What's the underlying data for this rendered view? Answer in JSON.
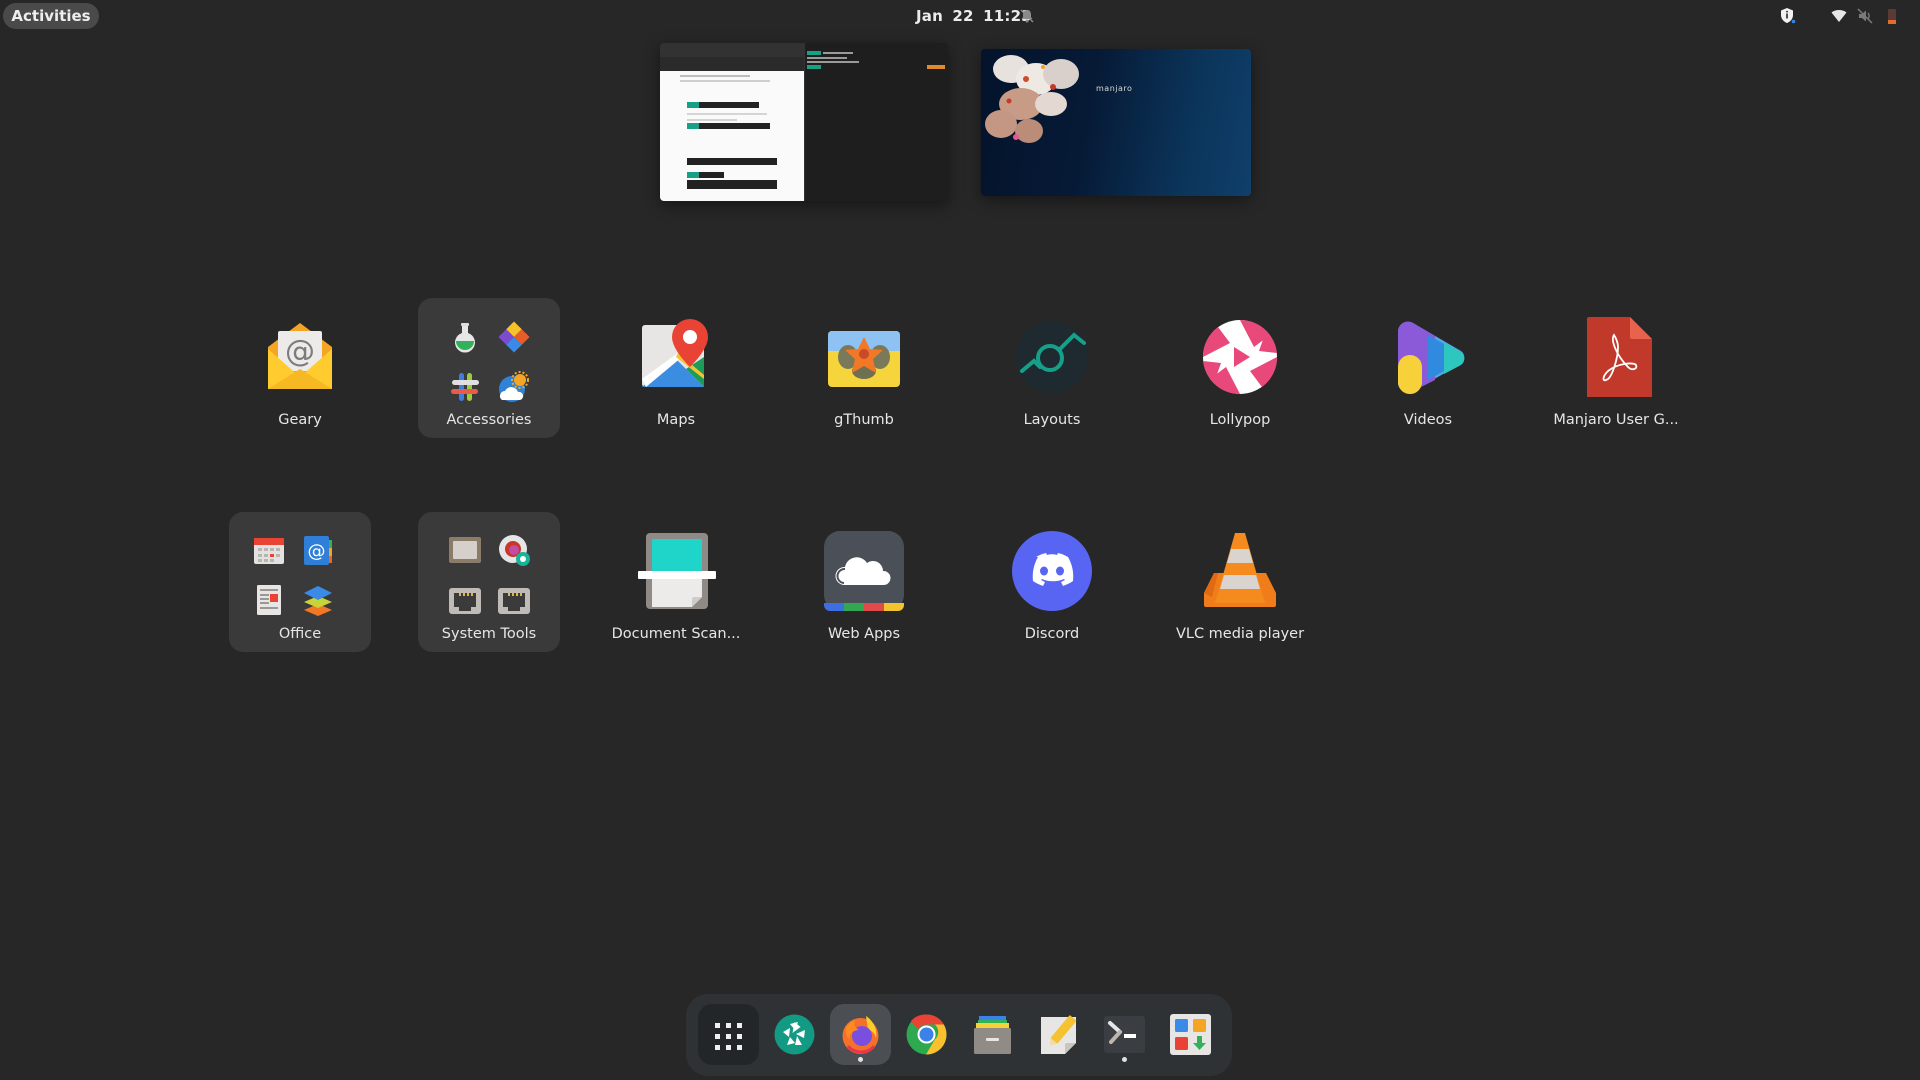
{
  "panel": {
    "activities_label": "Activities",
    "date": "Jan 22",
    "time": "11:23",
    "dnd_icon": "notifications-disabled-icon",
    "tray": [
      {
        "name": "security-shield-icon"
      },
      {
        "name": "wifi-icon"
      },
      {
        "name": "volume-muted-icon"
      },
      {
        "name": "battery-low-icon"
      }
    ]
  },
  "workspaces": [
    {
      "index": 1,
      "windows": [
        "Google Docs in browser",
        "Terminal"
      ]
    },
    {
      "index": 2,
      "wallpaper_text": "manjaro"
    }
  ],
  "app_grid": {
    "rows": [
      [
        {
          "label": "Geary",
          "type": "app",
          "icon": "mail-icon"
        },
        {
          "label": "Accessories",
          "type": "folder",
          "icon": "folder-icon"
        },
        {
          "label": "Maps",
          "type": "app",
          "icon": "maps-icon"
        },
        {
          "label": "gThumb",
          "type": "app",
          "icon": "image-viewer-icon"
        },
        {
          "label": "Layouts",
          "type": "app",
          "icon": "layouts-icon"
        },
        {
          "label": "Lollypop",
          "type": "app",
          "icon": "music-player-icon"
        },
        {
          "label": "Videos",
          "type": "app",
          "icon": "video-player-icon"
        },
        {
          "label": "Manjaro User G...",
          "type": "app",
          "icon": "pdf-document-icon"
        }
      ],
      [
        {
          "label": "Office",
          "type": "folder",
          "icon": "folder-icon"
        },
        {
          "label": "System Tools",
          "type": "folder",
          "icon": "folder-icon"
        },
        {
          "label": "Document Scan...",
          "type": "app",
          "icon": "scanner-icon"
        },
        {
          "label": "Web Apps",
          "type": "app",
          "icon": "cloud-icon"
        },
        {
          "label": "Discord",
          "type": "app",
          "icon": "discord-icon"
        },
        {
          "label": "VLC media player",
          "type": "app",
          "icon": "vlc-cone-icon"
        }
      ]
    ]
  },
  "dock": {
    "items": [
      {
        "name": "show-applications",
        "icon": "app-grid-icon",
        "running": false
      },
      {
        "name": "screenshot-tool",
        "icon": "camera-aperture-icon",
        "running": false
      },
      {
        "name": "firefox",
        "icon": "firefox-icon",
        "running": true,
        "focused": true
      },
      {
        "name": "chrome",
        "icon": "chrome-icon",
        "running": false
      },
      {
        "name": "files",
        "icon": "file-cabinet-icon",
        "running": false
      },
      {
        "name": "text-editor",
        "icon": "text-editor-icon",
        "running": false
      },
      {
        "name": "terminal",
        "icon": "terminal-icon",
        "running": true
      },
      {
        "name": "software",
        "icon": "software-center-icon",
        "running": false
      }
    ]
  },
  "colors": {
    "background": "#272727",
    "folder_tile": "#3a3a3a",
    "dock": "#2f3235",
    "accent_teal": "#16a085",
    "discord_blurple": "#5865f2"
  }
}
